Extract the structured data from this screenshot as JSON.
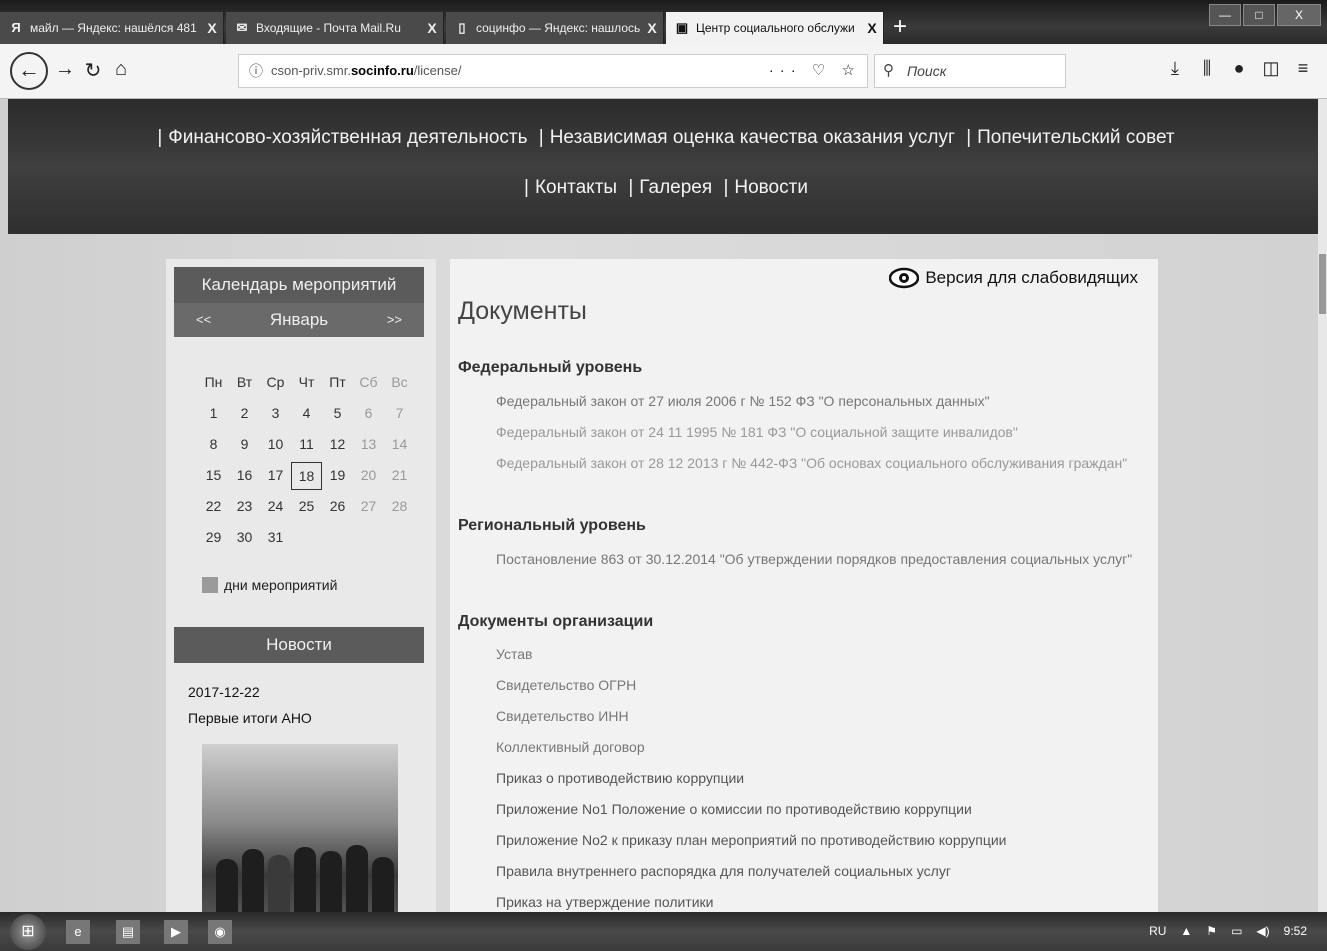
{
  "browser": {
    "tabs": [
      {
        "icon": "Я",
        "title": "майл — Яндекс: нашёлся 481",
        "close": "X"
      },
      {
        "icon": "✉",
        "title": "Входящие - Почта Mail.Ru",
        "close": "X"
      },
      {
        "icon": "▯",
        "title": "социнфо — Яндекс: нашлось",
        "close": "X"
      },
      {
        "icon": "▣",
        "title": "Центр социального обслужи",
        "close": "X"
      }
    ],
    "new_tab": "+",
    "window_buttons": {
      "minimize": "—",
      "maximize": "□",
      "close": "X"
    },
    "url_prefix": "cson-priv.smr.",
    "url_bold": "socinfo.ru",
    "url_suffix": "/license/",
    "url_actions": "··· ♡ ☆",
    "search_placeholder": "Поиск"
  },
  "header": {
    "menu_row_1": [
      "Финансово-хозяйственная деятельность",
      "Независимая оценка качества оказания услуг",
      "Попечительский совет"
    ],
    "menu_row_2": [
      "Контакты",
      "Галерея",
      "Новости"
    ],
    "separator": "|"
  },
  "sidebar": {
    "calendar_title": "Календарь мероприятий",
    "prev": "<<",
    "next": ">>",
    "month": "Январь",
    "weekdays": [
      "Пн",
      "Вт",
      "Ср",
      "Чт",
      "Пт",
      "Сб",
      "Вс"
    ],
    "weeks": [
      [
        "1",
        "2",
        "3",
        "4",
        "5",
        "6",
        "7"
      ],
      [
        "8",
        "9",
        "10",
        "11",
        "12",
        "13",
        "14"
      ],
      [
        "15",
        "16",
        "17",
        "18",
        "19",
        "20",
        "21"
      ],
      [
        "22",
        "23",
        "24",
        "25",
        "26",
        "27",
        "28"
      ],
      [
        "29",
        "30",
        "31",
        "",
        "",
        "",
        ""
      ]
    ],
    "today": "18",
    "legend": "дни мероприятий",
    "news_title": "Новости",
    "news_date": "2017-12-22",
    "news_headline": "Первые итоги АНО"
  },
  "content": {
    "low_vision": "Версия для слабовидящих",
    "title": "Документы",
    "sections": [
      {
        "heading": "Федеральный уровень",
        "docs": [
          "Федеральный закон от 27 июля 2006 г № 152 ФЗ \"О персональных данных\"",
          "Федеральный закон от 24 11 1995 № 181 ФЗ \"О социальной защите инвалидов\"",
          "Федеральный закон от 28 12 2013 г № 442-ФЗ \"Об основах социального обслуживания граждан\""
        ]
      },
      {
        "heading": "Региональный уровень",
        "docs": [
          "Постановление 863 от 30.12.2014 \"Об утверждении порядков предоставления социальных услуг\""
        ]
      },
      {
        "heading": "Документы организации",
        "docs": [
          "Устав",
          "Свидетельство ОГРН",
          "Свидетельство ИНН",
          "Коллективный договор",
          "Приказ о противодействию коррупции",
          "Приложение No1 Положение о комиссии по противодействию коррупции",
          "Приложение No2 к приказу план мероприятий по противодействию коррупции",
          "Правила внутреннего распорядка для получателей социальных услуг",
          "Приказ на утверждение политики"
        ]
      }
    ]
  },
  "taskbar": {
    "lang": "RU",
    "time": "9:52"
  }
}
